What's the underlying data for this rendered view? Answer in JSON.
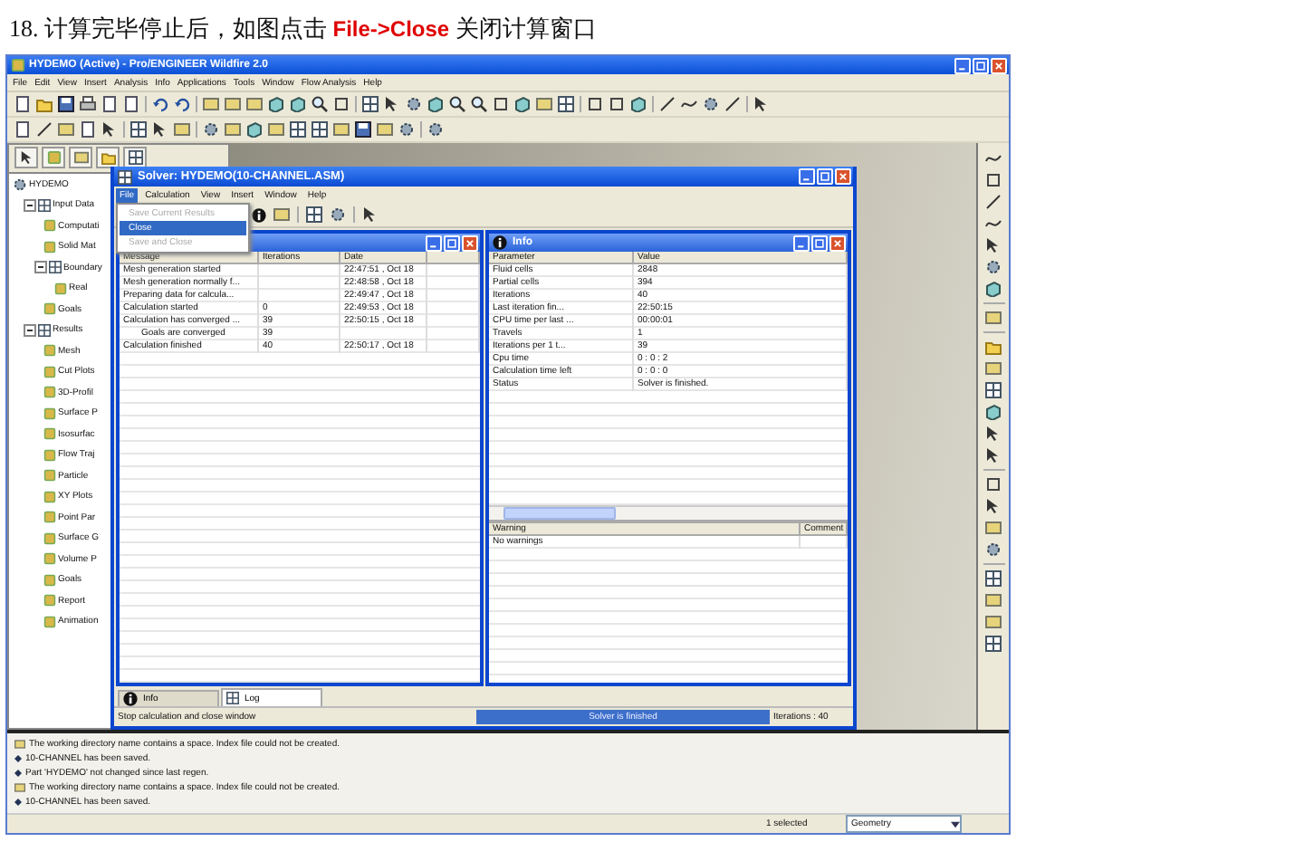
{
  "heading": "18. 计算完毕停止后，如图点击 **File->Close** 关闭计算窗口",
  "app": {
    "title": "HYDEMO (Active) - Pro/ENGINEER Wildfire 2.0",
    "menu": [
      "File",
      "Edit",
      "View",
      "Insert",
      "Analysis",
      "Info",
      "Applications",
      "Tools",
      "Window",
      "Flow Analysis",
      "Help"
    ],
    "model_tree": {
      "root": "HYDEMO",
      "items": [
        {
          "label": "Input Data",
          "expanded": true,
          "children": [
            {
              "label": "Computati"
            },
            {
              "label": "Solid Mat"
            },
            {
              "label": "Boundary",
              "expanded": true,
              "children": [
                {
                  "label": "Real"
                }
              ]
            },
            {
              "label": "Goals"
            }
          ]
        },
        {
          "label": "Results",
          "expanded": true,
          "children": [
            {
              "label": "Mesh"
            },
            {
              "label": "Cut Plots"
            },
            {
              "label": "3D-Profil"
            },
            {
              "label": "Surface P"
            },
            {
              "label": "Isosurfac"
            },
            {
              "label": "Flow Traj"
            },
            {
              "label": "Particle"
            },
            {
              "label": "XY Plots"
            },
            {
              "label": "Point Par"
            },
            {
              "label": "Surface G"
            },
            {
              "label": "Volume P"
            },
            {
              "label": "Goals"
            },
            {
              "label": "Report"
            },
            {
              "label": "Animation"
            }
          ]
        }
      ]
    },
    "messages": [
      {
        "kind": "info",
        "text": "The working directory name contains a space. Index file could not be created."
      },
      {
        "kind": "bullet",
        "text": "10-CHANNEL has been saved."
      },
      {
        "kind": "bullet",
        "text": "Part 'HYDEMO' not changed since last regen."
      },
      {
        "kind": "info",
        "text": "The working directory name contains a space. Index file could not be created."
      },
      {
        "kind": "bullet",
        "text": "10-CHANNEL has been saved."
      }
    ],
    "status_bar": {
      "selection": "1 selected",
      "filter": "Geometry"
    }
  },
  "solver": {
    "title": "Solver: HYDEMO(10-CHANNEL.ASM)",
    "menu": [
      {
        "label": "File",
        "selected": true
      },
      {
        "label": "Calculation",
        "selected": false
      },
      {
        "label": "View",
        "selected": false
      },
      {
        "label": "Insert",
        "selected": false
      },
      {
        "label": "Window",
        "selected": false
      },
      {
        "label": "Help",
        "selected": false
      }
    ],
    "file_menu": [
      {
        "label": "Save Current Results",
        "disabled": true,
        "selected": false
      },
      {
        "label": "Close",
        "disabled": false,
        "selected": true
      },
      {
        "label": "Save and Close",
        "disabled": true,
        "selected": false
      }
    ],
    "log": {
      "columns": [
        "Message",
        "Iterations",
        "Date"
      ],
      "rows": [
        {
          "message": "Mesh generation started",
          "date": "22:47:51 , Oct 18"
        },
        {
          "message": "Mesh generation normally f...",
          "date": "22:48:58 , Oct 18"
        },
        {
          "message": "Preparing data for calcula...",
          "date": "22:49:47 , Oct 18"
        },
        {
          "message": "Calculation started",
          "iterations": "0",
          "date": "22:49:53 , Oct 18"
        },
        {
          "message": "Calculation has converged ...",
          "iterations": "39",
          "date": "22:50:15 , Oct 18",
          "children": [
            {
              "message": "Goals are converged",
              "iterations": "39"
            }
          ]
        },
        {
          "message": "Calculation finished",
          "iterations": "40",
          "date": "22:50:17 , Oct 18"
        }
      ]
    },
    "info": {
      "title": "Info",
      "columns": [
        "Parameter",
        "Value"
      ],
      "rows": [
        [
          "Fluid cells",
          "2848"
        ],
        [
          "Partial cells",
          "394"
        ],
        [
          "Iterations",
          "40"
        ],
        [
          "Last iteration fin...",
          "22:50:15"
        ],
        [
          "CPU time per last ...",
          "00:00:01"
        ],
        [
          "Travels",
          "1"
        ],
        [
          "Iterations per 1 t...",
          "39"
        ],
        [
          "Cpu time",
          "0 : 0 : 2"
        ],
        [
          "Calculation time left",
          "0 : 0 : 0"
        ],
        [
          "Status",
          "Solver is finished."
        ]
      ]
    },
    "warnings": {
      "columns": [
        "Warning",
        "Comment"
      ],
      "rows": [
        "No warnings"
      ]
    },
    "tabs": [
      {
        "label": "Info",
        "selected": false
      },
      {
        "label": "Log",
        "selected": true
      }
    ],
    "status": {
      "hint": "Stop calculation and close window",
      "progress_text": "Solver is finished",
      "iterations": "Iterations : 40"
    }
  }
}
